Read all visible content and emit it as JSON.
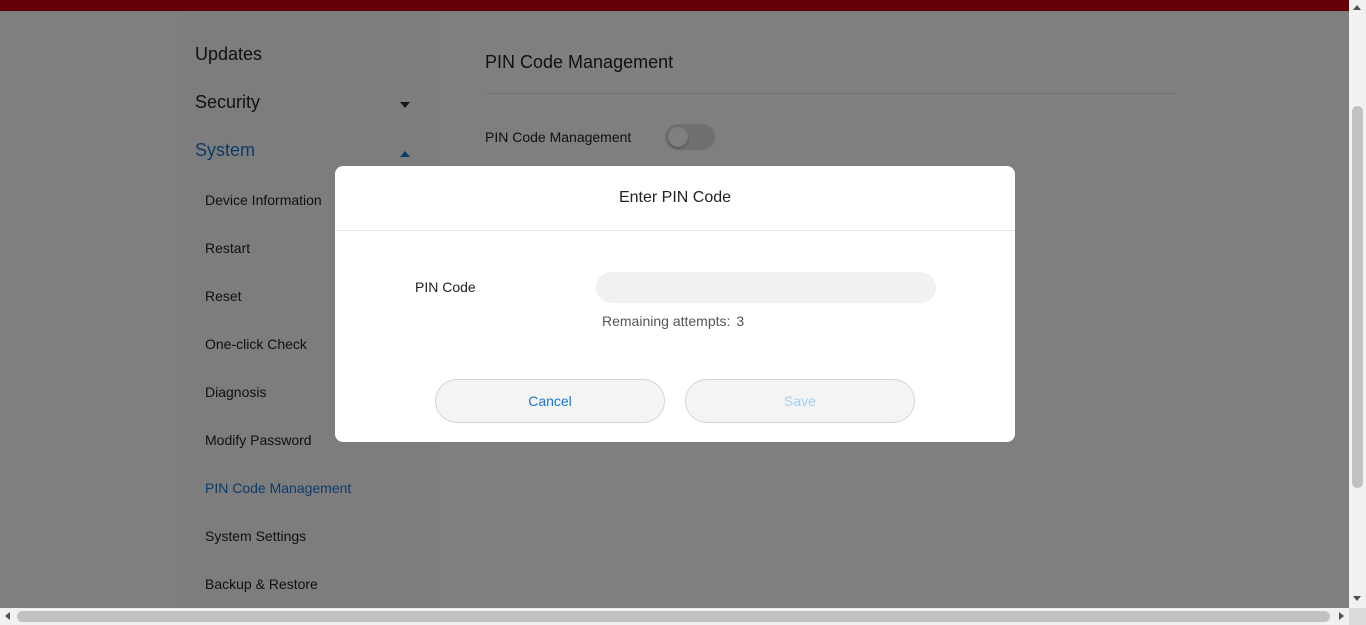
{
  "colors": {
    "brand_bar": "#c8000b",
    "accent": "#1a75d2",
    "save_disabled": "#a4cdf2"
  },
  "sidebar": {
    "sections": [
      {
        "label": "Updates",
        "expanded": false
      },
      {
        "label": "Security",
        "expanded": false,
        "caret": "chevron-down-icon"
      },
      {
        "label": "System",
        "expanded": true,
        "caret": "chevron-up-icon"
      }
    ],
    "system_items": [
      {
        "label": "Device Information"
      },
      {
        "label": "Restart"
      },
      {
        "label": "Reset"
      },
      {
        "label": "One-click Check"
      },
      {
        "label": "Diagnosis"
      },
      {
        "label": "Modify Password"
      },
      {
        "label": "PIN Code Management",
        "active": true
      },
      {
        "label": "System Settings"
      },
      {
        "label": "Backup & Restore"
      }
    ]
  },
  "main": {
    "title": "PIN Code Management",
    "toggle_label": "PIN Code Management",
    "toggle_on": false
  },
  "dialog": {
    "title": "Enter PIN Code",
    "field_label": "PIN Code",
    "pin_value": "",
    "remaining_label": "Remaining attempts:",
    "remaining_count": "3",
    "cancel_label": "Cancel",
    "save_label": "Save"
  }
}
